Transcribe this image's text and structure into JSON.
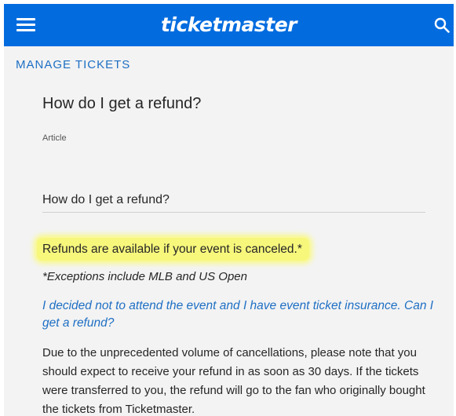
{
  "header": {
    "brand": "ticketmaster",
    "menu_icon": "hamburger-menu-icon",
    "search_icon": "search-icon",
    "color": "#026cdf"
  },
  "breadcrumb": {
    "section": "MANAGE TICKETS"
  },
  "article": {
    "title": "How do I get a refund?",
    "type": "Article",
    "heading": "How do I get a refund?",
    "highlight": "Refunds are available if your event is canceled.*",
    "exceptions": "*Exceptions include MLB and US Open",
    "question_link": "I decided not to attend the event and I have event ticket insurance. Can I get a refund?",
    "body": "Due to the unprecedented volume of cancellations, please note that you should expect to receive your refund in as soon as 30 days.  If the tickets were transferred to you, the refund will go to the fan who originally bought the tickets from Ticketmaster."
  },
  "colors": {
    "link": "#1e6fc4",
    "highlight": "#f7f77c",
    "background": "#f3f3f3"
  }
}
